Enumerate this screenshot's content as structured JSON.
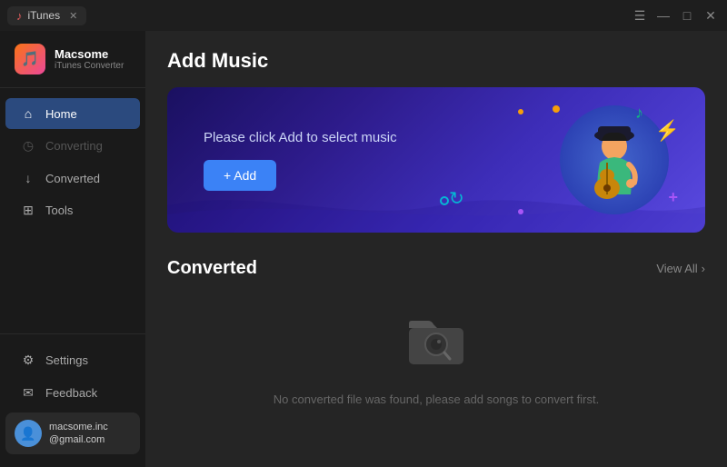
{
  "titlebar": {
    "tab_label": "iTunes",
    "tab_icon": "♪",
    "tab_close": "✕",
    "win_menu": "☰",
    "win_minimize": "—",
    "win_maximize": "□",
    "win_close": "✕"
  },
  "sidebar": {
    "logo_name": "Macsome",
    "logo_sub": "iTunes Converter",
    "logo_emoji": "🎵",
    "nav": [
      {
        "id": "home",
        "label": "Home",
        "icon": "⌂",
        "state": "active"
      },
      {
        "id": "converting",
        "label": "Converting",
        "icon": "◷",
        "state": "disabled"
      },
      {
        "id": "converted",
        "label": "Converted",
        "icon": "↓",
        "state": "normal"
      },
      {
        "id": "tools",
        "label": "Tools",
        "icon": "⊞",
        "state": "normal"
      }
    ],
    "bottom": [
      {
        "id": "settings",
        "label": "Settings",
        "icon": "⚙"
      },
      {
        "id": "feedback",
        "label": "Feedback",
        "icon": "✉"
      }
    ],
    "user": {
      "name": "macsome.inc\n@gmail.com",
      "avatar": "👤"
    }
  },
  "content": {
    "add_music_title": "Add Music",
    "banner_text": "Please click Add to select music",
    "add_btn": "+ Add",
    "converted_title": "Converted",
    "view_all": "View All",
    "empty_text": "No converted file was found, please add songs to convert first."
  }
}
